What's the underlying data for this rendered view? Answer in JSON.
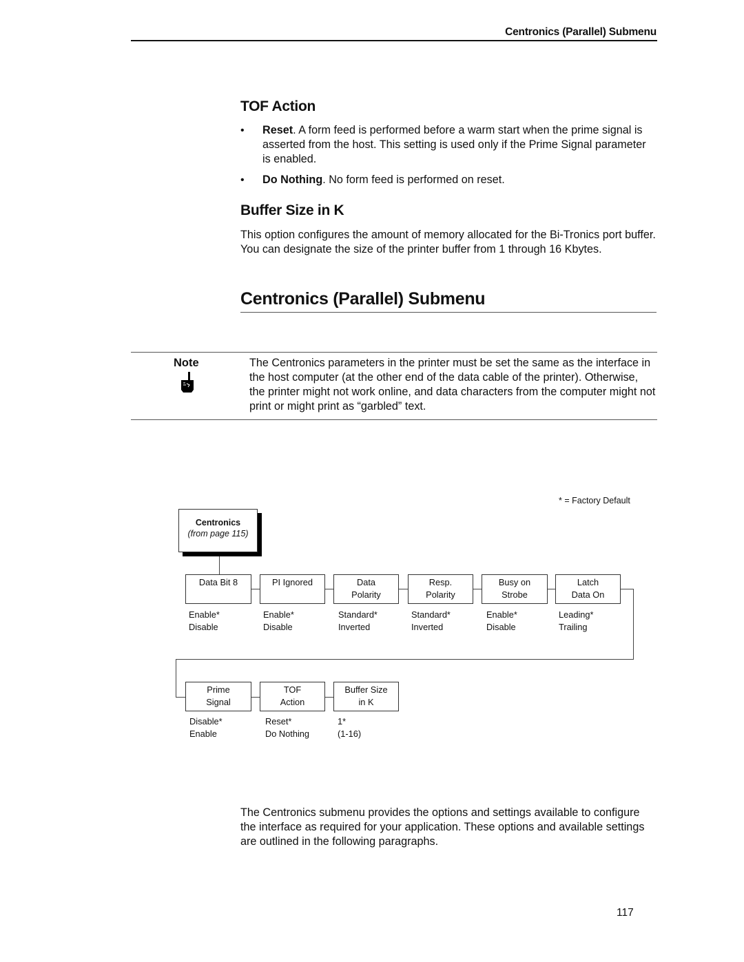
{
  "running_head": "Centronics (Parallel) Submenu",
  "tof_action": {
    "heading": "TOF Action",
    "bullets": [
      {
        "term": "Reset",
        "text": ". A form feed is performed before a warm start when the prime signal is asserted from the host. This setting is used only if the Prime Signal parameter is enabled."
      },
      {
        "term": "Do Nothing",
        "text": ". No form feed is performed on reset."
      }
    ],
    "bullet_glyph": "•"
  },
  "buffer_size": {
    "heading": "Buffer Size in K",
    "paragraph": "This option configures the amount of memory allocated for the Bi-Tronics port buffer. You can designate the size of the printer buffer from 1 through 16 Kbytes."
  },
  "centronics_section": {
    "heading": "Centronics (Parallel) Submenu"
  },
  "note": {
    "label": "Note",
    "icon": "pointing-hand-icon",
    "text": "The Centronics parameters in the printer must be set the same as the interface in the host computer (at the other end of the data cable of the printer). Otherwise, the printer might not work online, and data characters from the computer might not print or might print as “garbled” text."
  },
  "diagram": {
    "legend": "* = Factory Default",
    "root": {
      "title": "Centronics",
      "subtitle": "(from page 115)"
    },
    "row1": [
      {
        "line1": "Data Bit 8",
        "line2": "",
        "options": [
          "Enable*",
          "Disable"
        ]
      },
      {
        "line1": "PI Ignored",
        "line2": "",
        "options": [
          "Enable*",
          "Disable"
        ]
      },
      {
        "line1": "Data",
        "line2": "Polarity",
        "options": [
          "Standard*",
          "Inverted"
        ]
      },
      {
        "line1": "Resp.",
        "line2": "Polarity",
        "options": [
          "Standard*",
          "Inverted"
        ]
      },
      {
        "line1": "Busy on",
        "line2": "Strobe",
        "options": [
          "Enable*",
          "Disable"
        ]
      },
      {
        "line1": "Latch",
        "line2": "Data On",
        "options": [
          "Leading*",
          "Trailing"
        ]
      }
    ],
    "row2": [
      {
        "line1": "Prime",
        "line2": "Signal",
        "options": [
          "Disable*",
          "Enable"
        ]
      },
      {
        "line1": "TOF",
        "line2": "Action",
        "options": [
          "Reset*",
          "Do Nothing"
        ]
      },
      {
        "line1": "Buffer Size",
        "line2": "in K",
        "options": [
          "1*",
          "(1-16)"
        ]
      }
    ]
  },
  "closing_paragraph": "The Centronics submenu provides the options and settings available to configure the interface as required for your application. These options and available settings are outlined in the following paragraphs.",
  "page_number": "117"
}
